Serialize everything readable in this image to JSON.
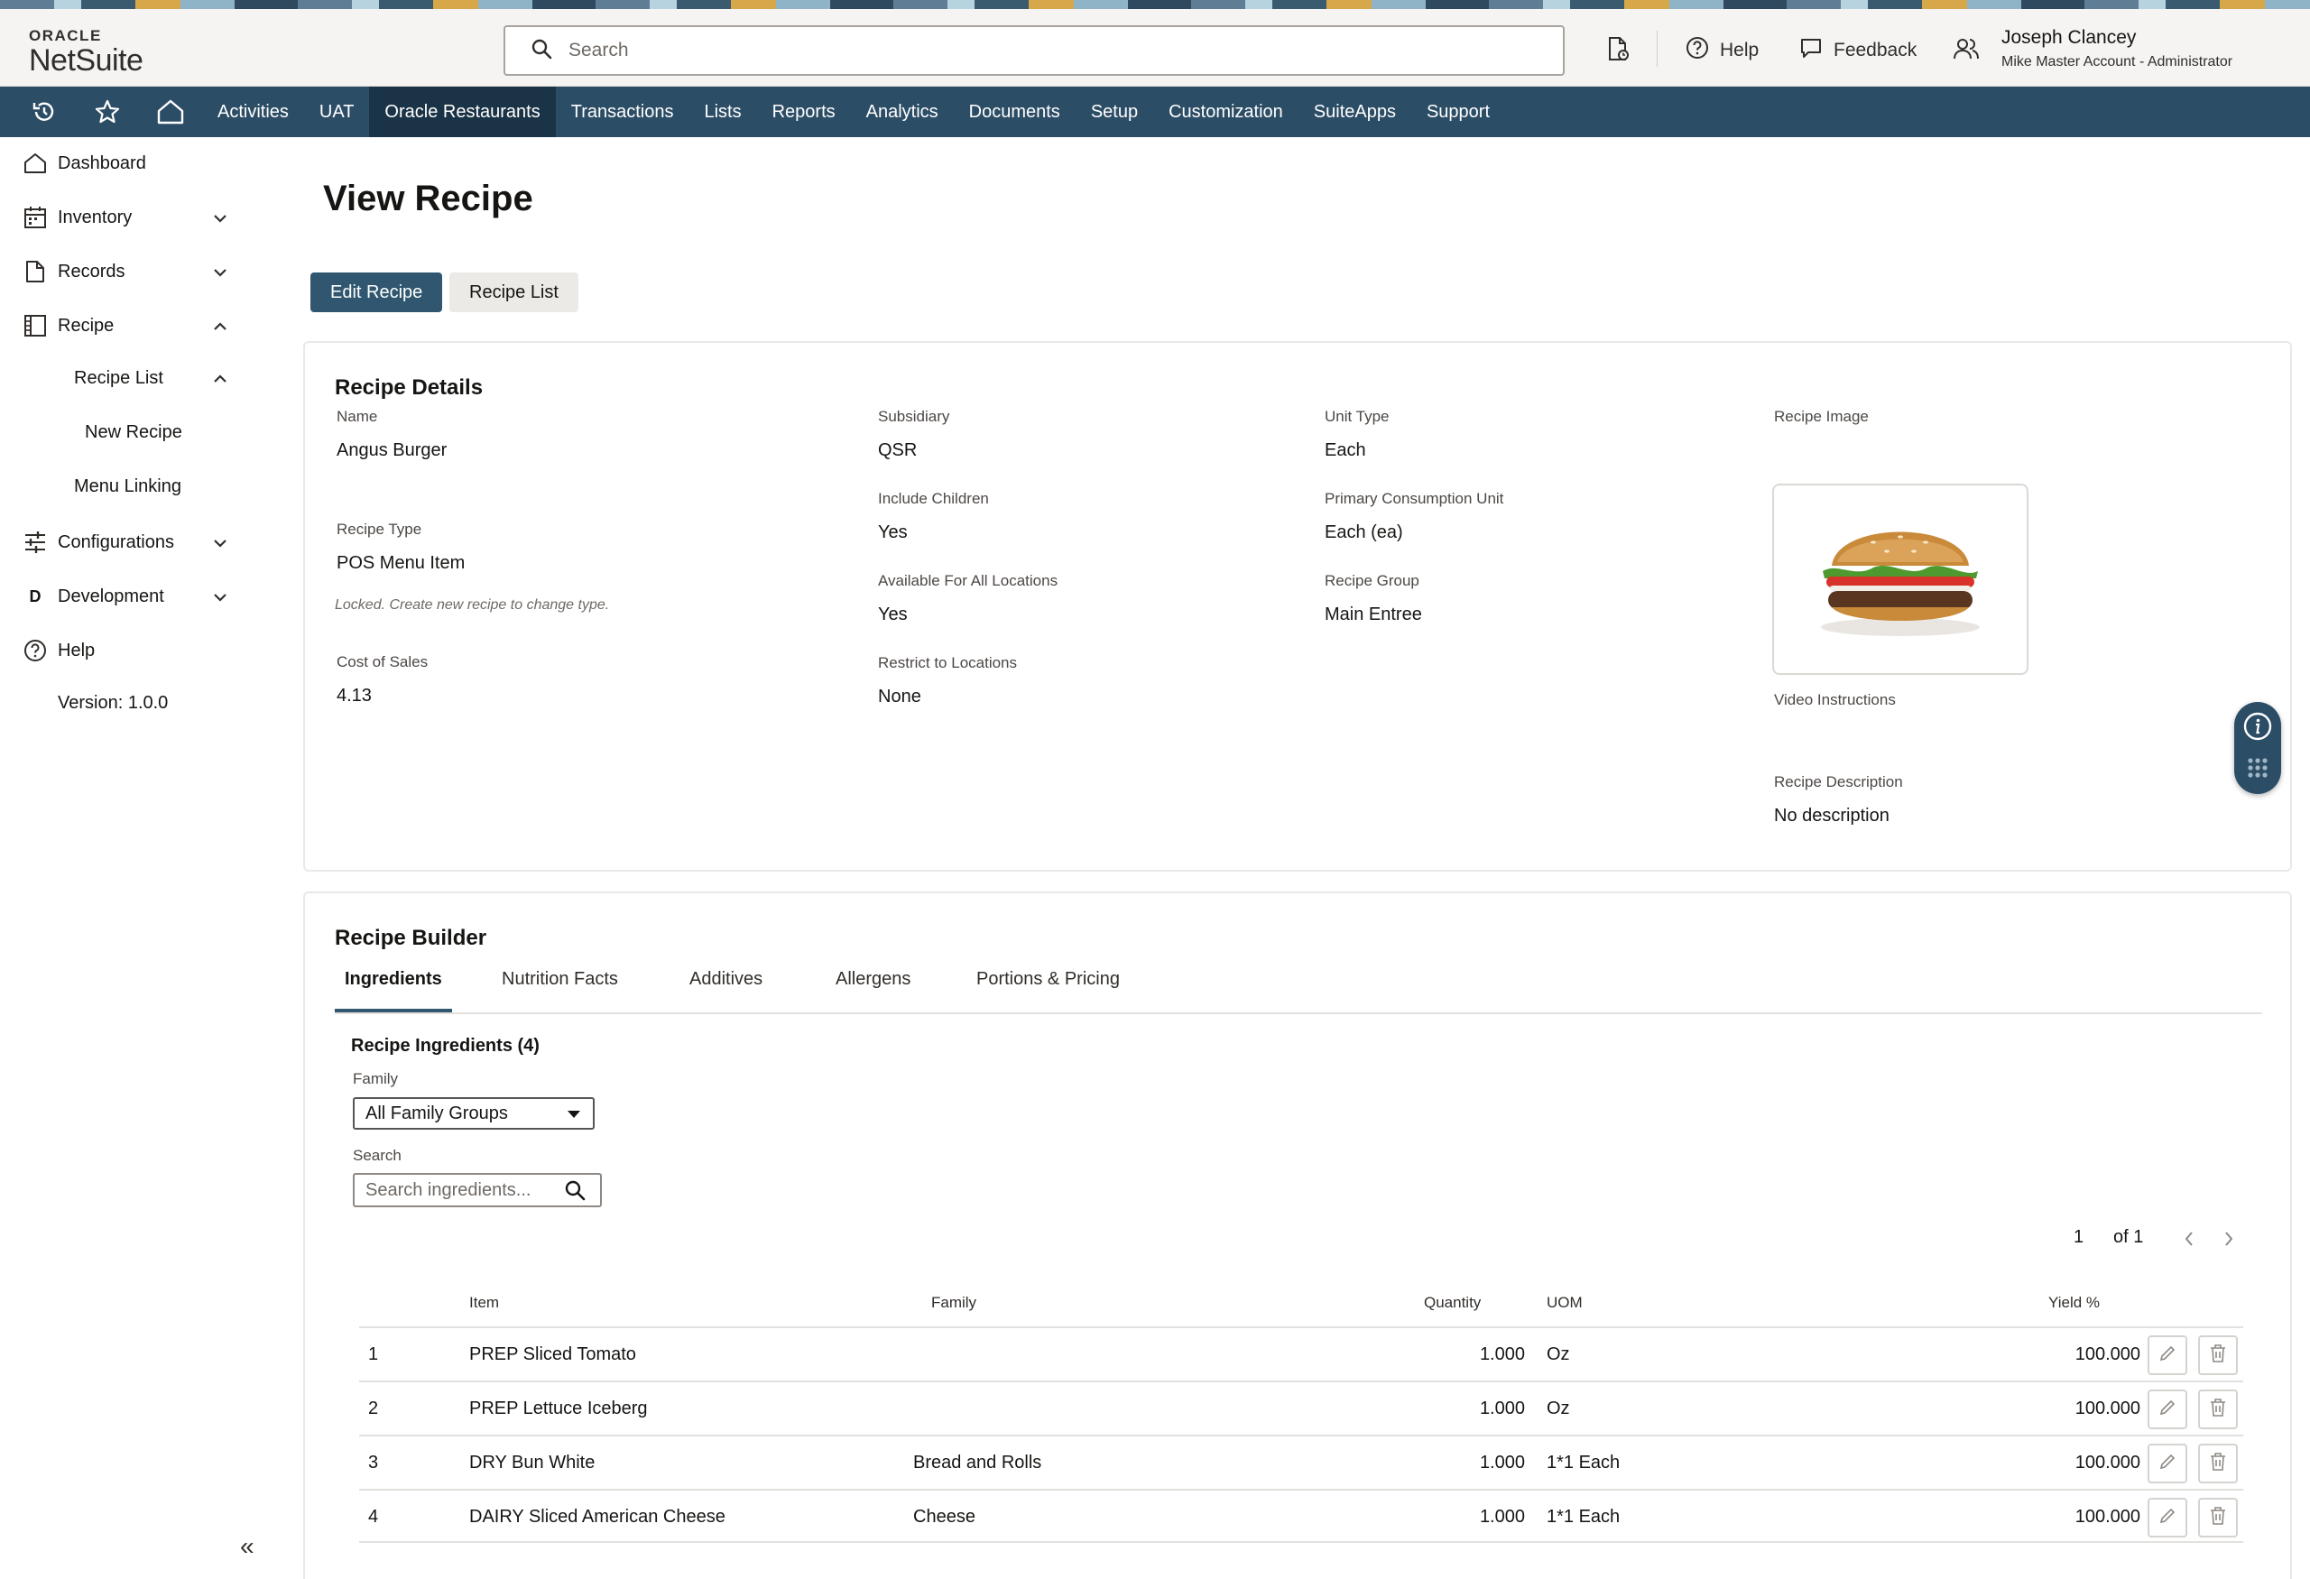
{
  "header": {
    "logo_top": "ORACLE",
    "logo_main": "NetSuite",
    "search_placeholder": "Search",
    "help_label": "Help",
    "feedback_label": "Feedback",
    "user_name": "Joseph Clancey",
    "user_role": "Mike Master Account - Administrator"
  },
  "nav": {
    "items": [
      "Activities",
      "UAT",
      "Oracle Restaurants",
      "Transactions",
      "Lists",
      "Reports",
      "Analytics",
      "Documents",
      "Setup",
      "Customization",
      "SuiteApps",
      "Support"
    ],
    "active": "Oracle Restaurants"
  },
  "sidebar": {
    "dashboard": "Dashboard",
    "inventory": "Inventory",
    "records": "Records",
    "recipe": "Recipe",
    "recipe_list": "Recipe List",
    "new_recipe": "New Recipe",
    "menu_linking": "Menu Linking",
    "configurations": "Configurations",
    "development": "Development",
    "development_letter": "D",
    "help": "Help",
    "version": "Version: 1.0.0"
  },
  "page": {
    "title": "View Recipe",
    "edit_button": "Edit Recipe",
    "list_button": "Recipe List"
  },
  "details": {
    "title": "Recipe Details",
    "name_label": "Name",
    "name_value": "Angus Burger",
    "recipe_type_label": "Recipe Type",
    "recipe_type_value": "POS Menu Item",
    "recipe_type_note": "Locked. Create new recipe to change type.",
    "cost_label": "Cost of Sales",
    "cost_value": "4.13",
    "subsidiary_label": "Subsidiary",
    "subsidiary_value": "QSR",
    "include_children_label": "Include Children",
    "include_children_value": "Yes",
    "available_label": "Available For All Locations",
    "available_value": "Yes",
    "restrict_label": "Restrict to Locations",
    "restrict_value": "None",
    "unit_type_label": "Unit Type",
    "unit_type_value": "Each",
    "primary_unit_label": "Primary Consumption Unit",
    "primary_unit_value": "Each (ea)",
    "group_label": "Recipe Group",
    "group_value": "Main Entree",
    "image_label": "Recipe Image",
    "video_label": "Video Instructions",
    "description_label": "Recipe Description",
    "description_value": "No description"
  },
  "builder": {
    "title": "Recipe Builder",
    "tabs": [
      "Ingredients",
      "Nutrition Facts",
      "Additives",
      "Allergens",
      "Portions & Pricing"
    ],
    "active_tab": "Ingredients",
    "ingredients_title": "Recipe Ingredients (4)",
    "family_label": "Family",
    "family_value": "All Family Groups",
    "search_label": "Search",
    "search_placeholder": "Search ingredients...",
    "page_current": "1",
    "page_total": "of 1",
    "columns": [
      "Item",
      "Family",
      "Quantity",
      "UOM",
      "Yield %"
    ],
    "rows": [
      {
        "num": "1",
        "item": "PREP Sliced Tomato",
        "family": "",
        "quantity": "1.000",
        "uom": "Oz",
        "yield": "100.000"
      },
      {
        "num": "2",
        "item": "PREP Lettuce Iceberg",
        "family": "",
        "quantity": "1.000",
        "uom": "Oz",
        "yield": "100.000"
      },
      {
        "num": "3",
        "item": "DRY Bun White",
        "family": "Bread and Rolls",
        "quantity": "1.000",
        "uom": "1*1 Each",
        "yield": "100.000"
      },
      {
        "num": "4",
        "item": "DAIRY Sliced American Cheese",
        "family": "Cheese",
        "quantity": "1.000",
        "uom": "1*1 Each",
        "yield": "100.000"
      }
    ]
  },
  "colors": {
    "navbar": "#2c4d66",
    "nav_active": "#1b3346",
    "primary_button": "#30576f"
  }
}
